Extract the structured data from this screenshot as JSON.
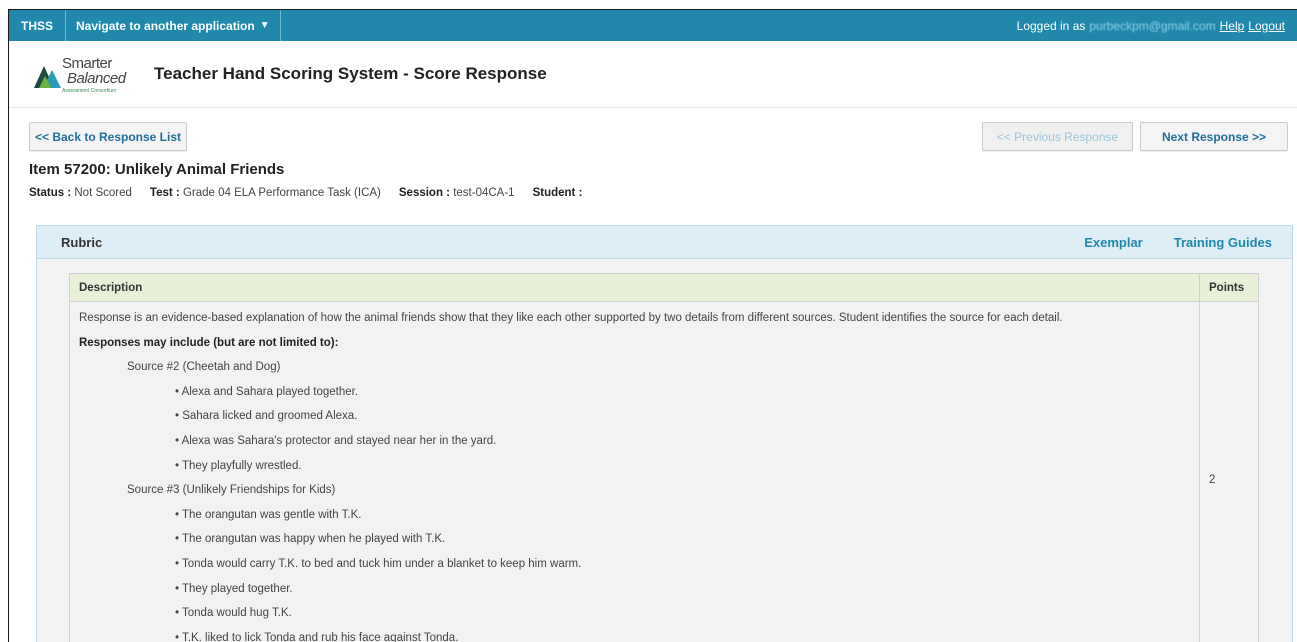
{
  "topbar": {
    "brand": "THSS",
    "nav_label": "Navigate to another application",
    "logged_in_prefix": "Logged in as",
    "email": "purbeckpm@gmail.com",
    "help": "Help",
    "logout": "Logout",
    "color": "#2089ab"
  },
  "header": {
    "logo_line1": "Smarter",
    "logo_line2": "Balanced",
    "logo_line3": "Assessment Consortium",
    "title": "Teacher Hand Scoring System - Score Response"
  },
  "buttons": {
    "back": "<< Back to Response List",
    "prev": "<< Previous Response",
    "next": "Next Response >>"
  },
  "item": {
    "title": "Item 57200: Unlikely Animal Friends",
    "status_label": "Status :",
    "status_value": "Not Scored",
    "test_label": "Test :",
    "test_value": "Grade 04 ELA Performance Task (ICA)",
    "session_label": "Session :",
    "session_value": "test-04CA-1",
    "student_label": "Student :",
    "student_value": ""
  },
  "rubric": {
    "title": "Rubric",
    "links": [
      "Exemplar",
      "Training Guides"
    ],
    "headers": [
      "Description",
      "Points"
    ],
    "points": "2",
    "lines": [
      {
        "type": "text",
        "text": "Response is an evidence-based explanation of how the animal friends show that they like each other supported by two details from different sources. Student identifies the source for each detail."
      },
      {
        "type": "bold",
        "text": "Responses may include (but are not limited to):"
      },
      {
        "type": "src",
        "text": "Source #2 (Cheetah and Dog)"
      },
      {
        "type": "bul",
        "text": "• Alexa and Sahara played together."
      },
      {
        "type": "bul",
        "text": "• Sahara licked and groomed Alexa."
      },
      {
        "type": "bul",
        "text": "• Alexa was Sahara's protector and stayed near her in the yard."
      },
      {
        "type": "bul",
        "text": "• They playfully wrestled."
      },
      {
        "type": "src",
        "text": "Source #3 (Unlikely Friendships for Kids)"
      },
      {
        "type": "bul",
        "text": "• The orangutan was gentle with T.K."
      },
      {
        "type": "bul",
        "text": "• The orangutan was happy when he played with T.K."
      },
      {
        "type": "bul",
        "text": "• Tonda would carry T.K. to bed and tuck him under a blanket to keep him warm."
      },
      {
        "type": "bul",
        "text": "• They played together."
      },
      {
        "type": "bul",
        "text": "• Tonda would hug T.K."
      },
      {
        "type": "bul",
        "text": "• T.K. liked to lick Tonda and rub his face against Tonda."
      }
    ]
  }
}
